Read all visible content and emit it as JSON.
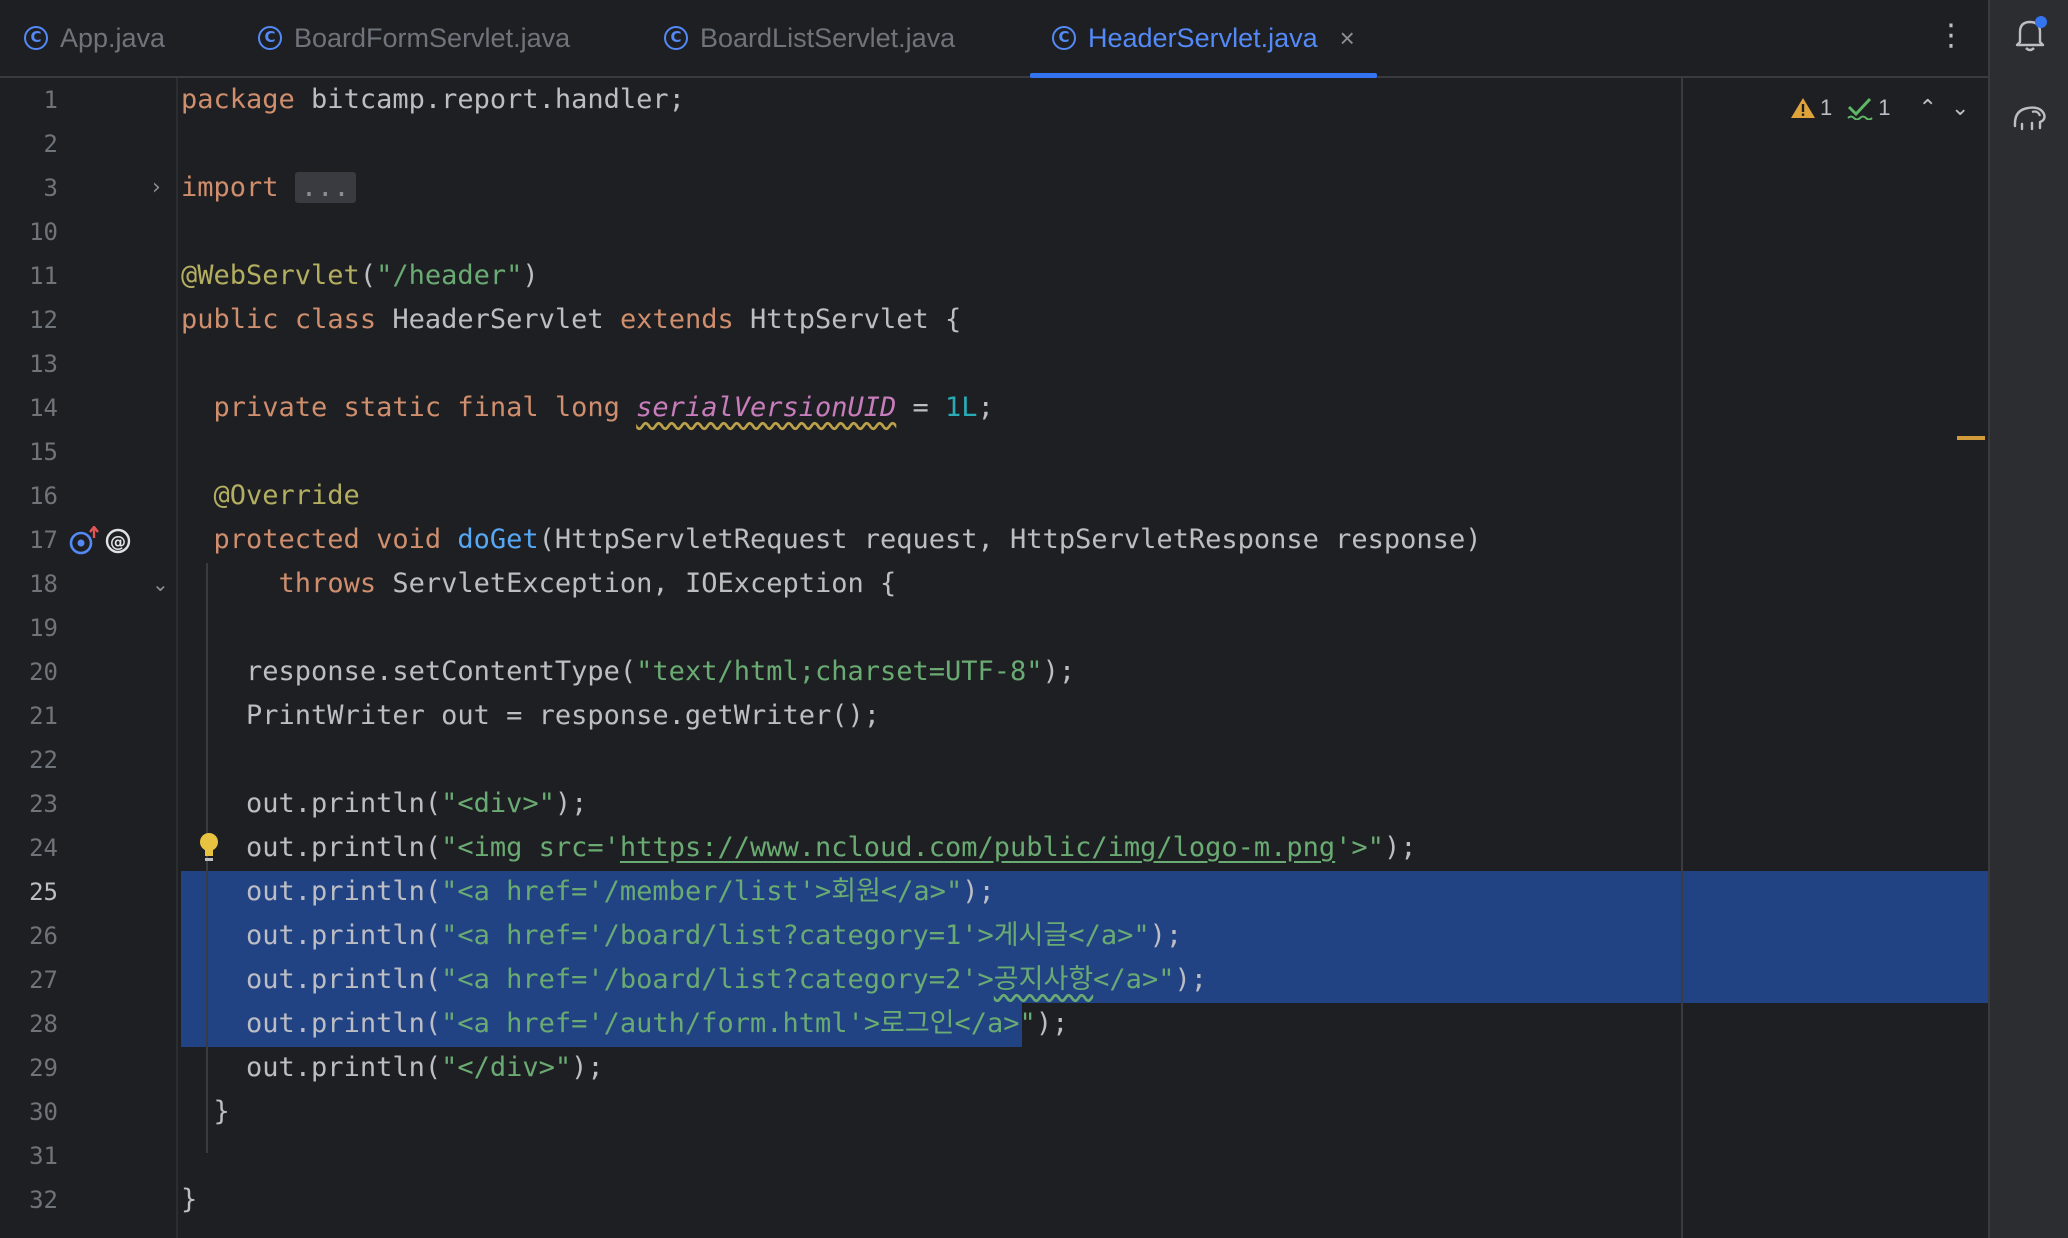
{
  "tabs": [
    {
      "label": "App.java",
      "active": false
    },
    {
      "label": "BoardFormServlet.java",
      "active": false
    },
    {
      "label": "BoardListServlet.java",
      "active": false
    },
    {
      "label": "HeaderServlet.java",
      "active": true
    }
  ],
  "tab_close_glyph": "×",
  "tab_menu_glyph": "⋮",
  "inspections": {
    "warnings": "1",
    "weak_warnings": "1"
  },
  "editor": {
    "current_line": "25",
    "line_numbers": [
      "1",
      "2",
      "3",
      "10",
      "11",
      "12",
      "13",
      "14",
      "15",
      "16",
      "17",
      "18",
      "19",
      "20",
      "21",
      "22",
      "23",
      "24",
      "25",
      "26",
      "27",
      "28",
      "29",
      "30",
      "31",
      "32"
    ],
    "code": {
      "l1_kw": "package",
      "l1_rest": " bitcamp.report.handler;",
      "l3_kw": "import",
      "l3_fold": "...",
      "l11_ann": "@WebServlet",
      "l11_p1": "(",
      "l11_str": "\"/header\"",
      "l11_p2": ")",
      "l12_kw1": "public",
      "l12_kw2": "class",
      "l12_name": " HeaderServlet ",
      "l12_kw3": "extends",
      "l12_rest": " HttpServlet {",
      "l14_kw": "private static final long",
      "l14_field": "serialVersionUID",
      "l14_eq": " = ",
      "l14_num": "1L",
      "l14_end": ";",
      "l16_ann": "@Override",
      "l17_kw": "protected void",
      "l17_fn": "doGet",
      "l17_rest": "(HttpServletRequest request, HttpServletResponse response)",
      "l18_kw": "throws",
      "l18_rest": " ServletException, IOException {",
      "l20_a": "response.setContentType(",
      "l20_str": "\"text/html;charset=UTF-8\"",
      "l20_b": ");",
      "l21": "PrintWriter out = response.getWriter();",
      "l23_a": "out.println(",
      "l23_str": "\"<div>\"",
      "l23_b": ");",
      "l24_a": "out.println(",
      "l24_s1": "\"<img src='",
      "l24_url": "https://www.ncloud.com/public/img/logo-m.png",
      "l24_s2": "'>\"",
      "l24_b": ");",
      "l25_a": "out.println(",
      "l25_str": "\"<a href='/member/list'>회원</a>\"",
      "l25_b": ");",
      "l26_a": "out.println(",
      "l26_str": "\"<a href='/board/list?category=1'>게시글</a>\"",
      "l26_b": ");",
      "l27_a": "out.println(",
      "l27_s1": "\"<a href='/board/list?category=2'>",
      "l27_typo": "공지사항",
      "l27_s2": "</a>\"",
      "l27_b": ");",
      "l28_a": "out.println(",
      "l28_str": "\"<a href='/auth/form.html'>로그인</a>\"",
      "l28_b": ");",
      "l29_a": "out.println(",
      "l29_str": "\"</div>\"",
      "l29_b": ");",
      "l30": "}",
      "l32": "}"
    }
  },
  "colors": {
    "background": "#1e1f22",
    "keyword": "#cf8e6d",
    "string": "#6aab73",
    "annotation": "#b3ae60",
    "number": "#2aacb8",
    "method": "#56a8f5",
    "field": "#c77dbb",
    "selection": "#214283",
    "accent": "#3574f0"
  }
}
